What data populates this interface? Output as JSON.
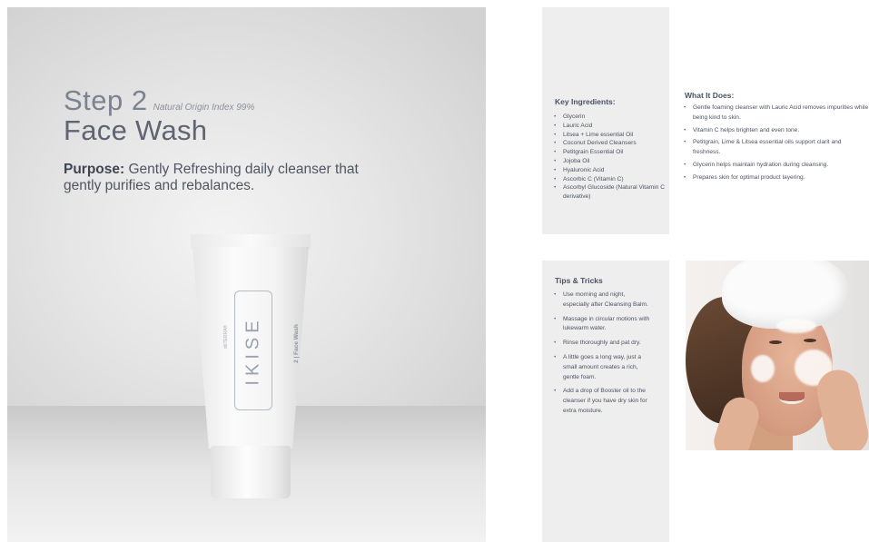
{
  "hero": {
    "step_label": "Step 2",
    "natural_origin_index": "Natural Origin Index 99%",
    "product_name": "Face Wash",
    "purpose_label": "Purpose:",
    "purpose_text": "Gently Refreshing daily cleanser that gently purifies and rebalances."
  },
  "tube": {
    "brand": "dōTERRA®",
    "name": "IKISE",
    "subtitle": "2 | Face Wash"
  },
  "ingredients": {
    "title": "Key Ingredients:",
    "items": [
      "Glycerin",
      "Lauric Acid",
      "Litsea + Lime essential Oil",
      "Coconut Derived Cleansers",
      "Petitgrain Essential Oil",
      "Jojoba Oil",
      "Hyaluronic Acid",
      "Ascorbic C (Vitamin C)",
      "Ascorbyl Glucoside (Natural Vitamin C derivative)"
    ]
  },
  "what_it_does": {
    "title": "What It Does:",
    "items": [
      "Gentle foaming cleanser with Lauric Acid removes impurities while being kind to skin.",
      "Vitamin C helps brighten and even tone.",
      "Petitgrain, Lime & Litsea essential oils support clarit and freshness.",
      "Glycerin helps maintain hydration during cleansing.",
      "Prepares skin for optimal product layering."
    ]
  },
  "tips": {
    "title": "Tips & Tricks",
    "items": [
      "Use morning and night, especially after Cleansing Balm.",
      "Massage in circular motions with lukewarm water.",
      "Rinse thoroughly and pat dry.",
      "A little goes a long way, just a small amount creates a rich, gentle foam.",
      "Add a drop of Booster oil to the cleanser if you have dry skin for extra moisture."
    ]
  }
}
